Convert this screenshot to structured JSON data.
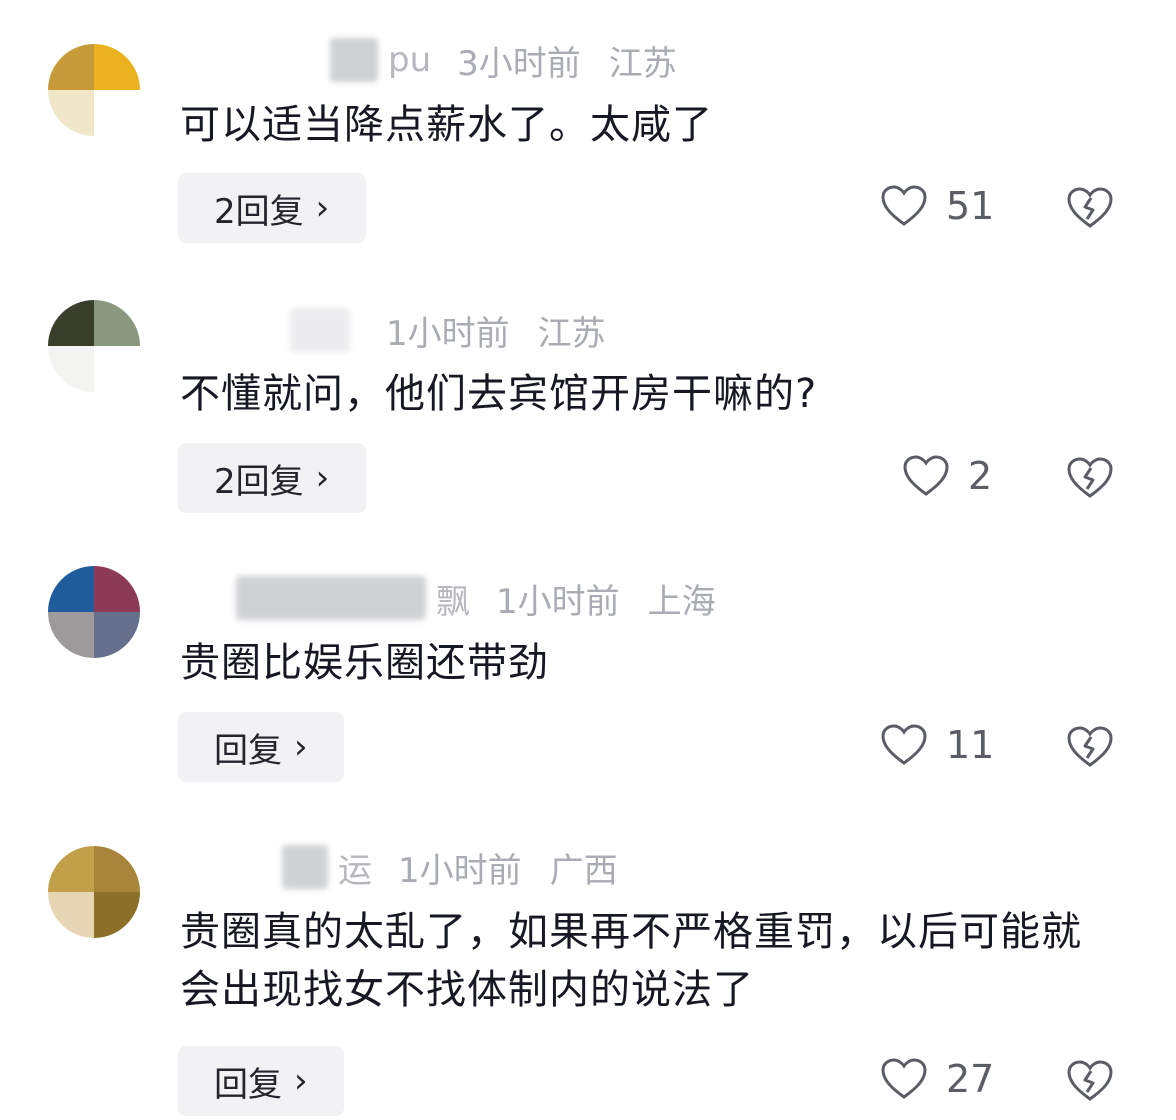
{
  "comments": [
    {
      "name_tail": "pu",
      "time": "3小时前",
      "location": "江苏",
      "text": "可以适当降点薪水了。太咸了",
      "reply_label": "2回复",
      "likes": "51",
      "avatar_colors": [
        "#c79b3a",
        "#e9b21e",
        "#f0e6c8",
        "#ffffff"
      ]
    },
    {
      "name_tail": "",
      "time": "1小时前",
      "location": "江苏",
      "text": "不懂就问，他们去宾馆开房干嘛的?",
      "reply_label": "2回复",
      "likes": "2",
      "avatar_colors": [
        "#3a3f2c",
        "#8b9880",
        "#f4f4f2",
        "#ffffff"
      ]
    },
    {
      "name_tail": "飘",
      "time": "1小时前",
      "location": "上海",
      "text": "贵圈比娱乐圈还带劲",
      "reply_label": "回复",
      "likes": "11",
      "avatar_colors": [
        "#1f5c9c",
        "#8c3a55",
        "#9e9a9c",
        "#66708c"
      ]
    },
    {
      "name_tail": "运",
      "time": "1小时前",
      "location": "广西",
      "text": "贵圈真的太乱了，如果再不严格重罚，以后可能就会出现找女不找体制内的说法了",
      "reply_label": "回复",
      "likes": "27",
      "avatar_colors": [
        "#c2a04a",
        "#a8853a",
        "#e6d6b4",
        "#8c7028"
      ]
    }
  ],
  "chevron": "›",
  "colors": {
    "meta": "#a9acb2",
    "text": "#161823",
    "reply_bg": "#f2f2f4"
  }
}
